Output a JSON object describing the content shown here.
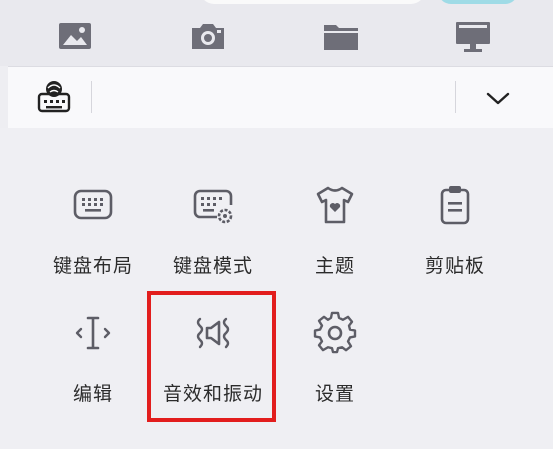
{
  "attachments": {
    "image_icon": "image-icon",
    "camera_icon": "camera-icon",
    "folder_icon": "folder-icon",
    "screen_icon": "monitor-icon"
  },
  "toolbar": {
    "keyboard_switch_icon": "keyboard-globe-icon",
    "collapse_icon": "chevron-down-icon"
  },
  "menu": {
    "items": [
      {
        "label": "键盘布局",
        "icon": "keyboard-icon"
      },
      {
        "label": "键盘模式",
        "icon": "keyboard-settings-icon"
      },
      {
        "label": "主题",
        "icon": "tshirt-icon"
      },
      {
        "label": "剪贴板",
        "icon": "clipboard-icon"
      },
      {
        "label": "编辑",
        "icon": "text-cursor-icon"
      },
      {
        "label": "音效和振动",
        "icon": "sound-vibration-icon"
      },
      {
        "label": "设置",
        "icon": "gear-icon"
      }
    ]
  },
  "colors": {
    "icon": "#5d5d66",
    "highlight": "#e21d1d",
    "accent": "#9fdbe6"
  }
}
